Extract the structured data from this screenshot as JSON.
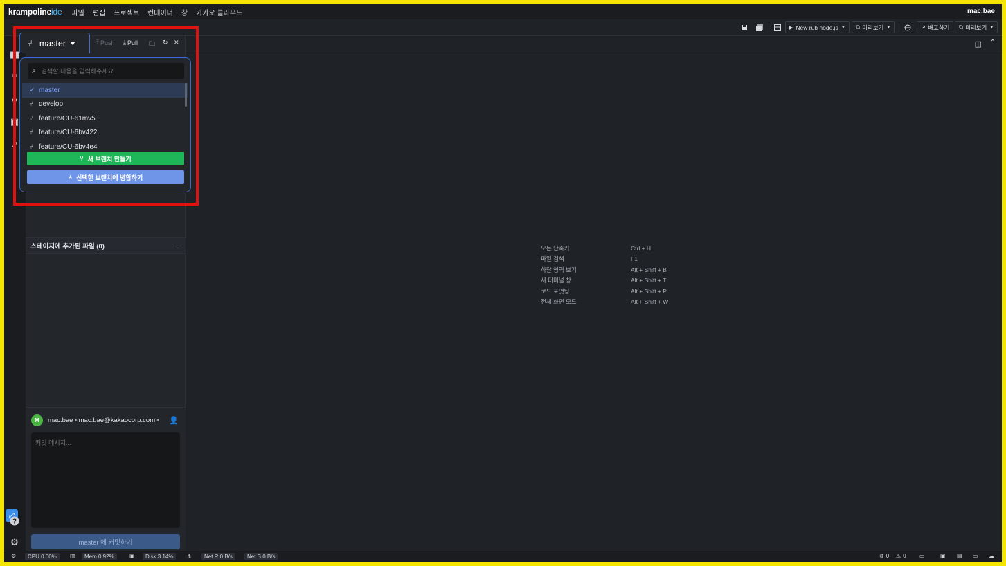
{
  "app": {
    "logo_main": "krampoline",
    "logo_accent": "ide",
    "user": "mac.bae"
  },
  "menu": [
    "파일",
    "편집",
    "프로젝트",
    "컨테이너",
    "창",
    "카카오 클라우드"
  ],
  "toolbar": {
    "run_label": "New rub node.js",
    "preview_label": "미리보기",
    "deploy_label": "배포하기",
    "preview2_label": "미리보기"
  },
  "git": {
    "current_branch": "master",
    "push_label": "Push",
    "pull_label": "Pull",
    "search_placeholder": "검색할 내용을 입력해주세요",
    "branches": [
      {
        "name": "master",
        "selected": true
      },
      {
        "name": "develop",
        "selected": false
      },
      {
        "name": "feature/CU-61mv5",
        "selected": false
      },
      {
        "name": "feature/CU-6bv422",
        "selected": false
      },
      {
        "name": "feature/CU-6bv4e4",
        "selected": false
      }
    ],
    "new_branch_label": "새 브랜치 만들기",
    "merge_label": "선택한 브랜치에 병합하기"
  },
  "panel": {
    "staged_header": "스테이지에 추가된 파일 (0)",
    "author": "mac.bae <mac.bae@kakaocorp.com>",
    "avatar_letter": "M",
    "commit_placeholder": "커밋 메시지...",
    "commit_button": "master 에 커밋하기"
  },
  "shortcuts": [
    {
      "label": "모든 단축키",
      "keys": "Ctrl + H"
    },
    {
      "label": "파일 검색",
      "keys": "F1"
    },
    {
      "label": "하단 영역 보기",
      "keys": "Alt + Shift + B"
    },
    {
      "label": "새 터미널 창",
      "keys": "Alt + Shift + T"
    },
    {
      "label": "코드 포맷팅",
      "keys": "Alt + Shift + P"
    },
    {
      "label": "전체 화면 모드",
      "keys": "Alt + Shift + W"
    }
  ],
  "status": {
    "cpu": "CPU 0.00%",
    "mem": "Mem 0.92%",
    "disk": "Disk 3.14%",
    "net_r": "Net R 0 B/s",
    "net_s": "Net S 0 B/s",
    "errors": "0",
    "warnings": "0"
  }
}
